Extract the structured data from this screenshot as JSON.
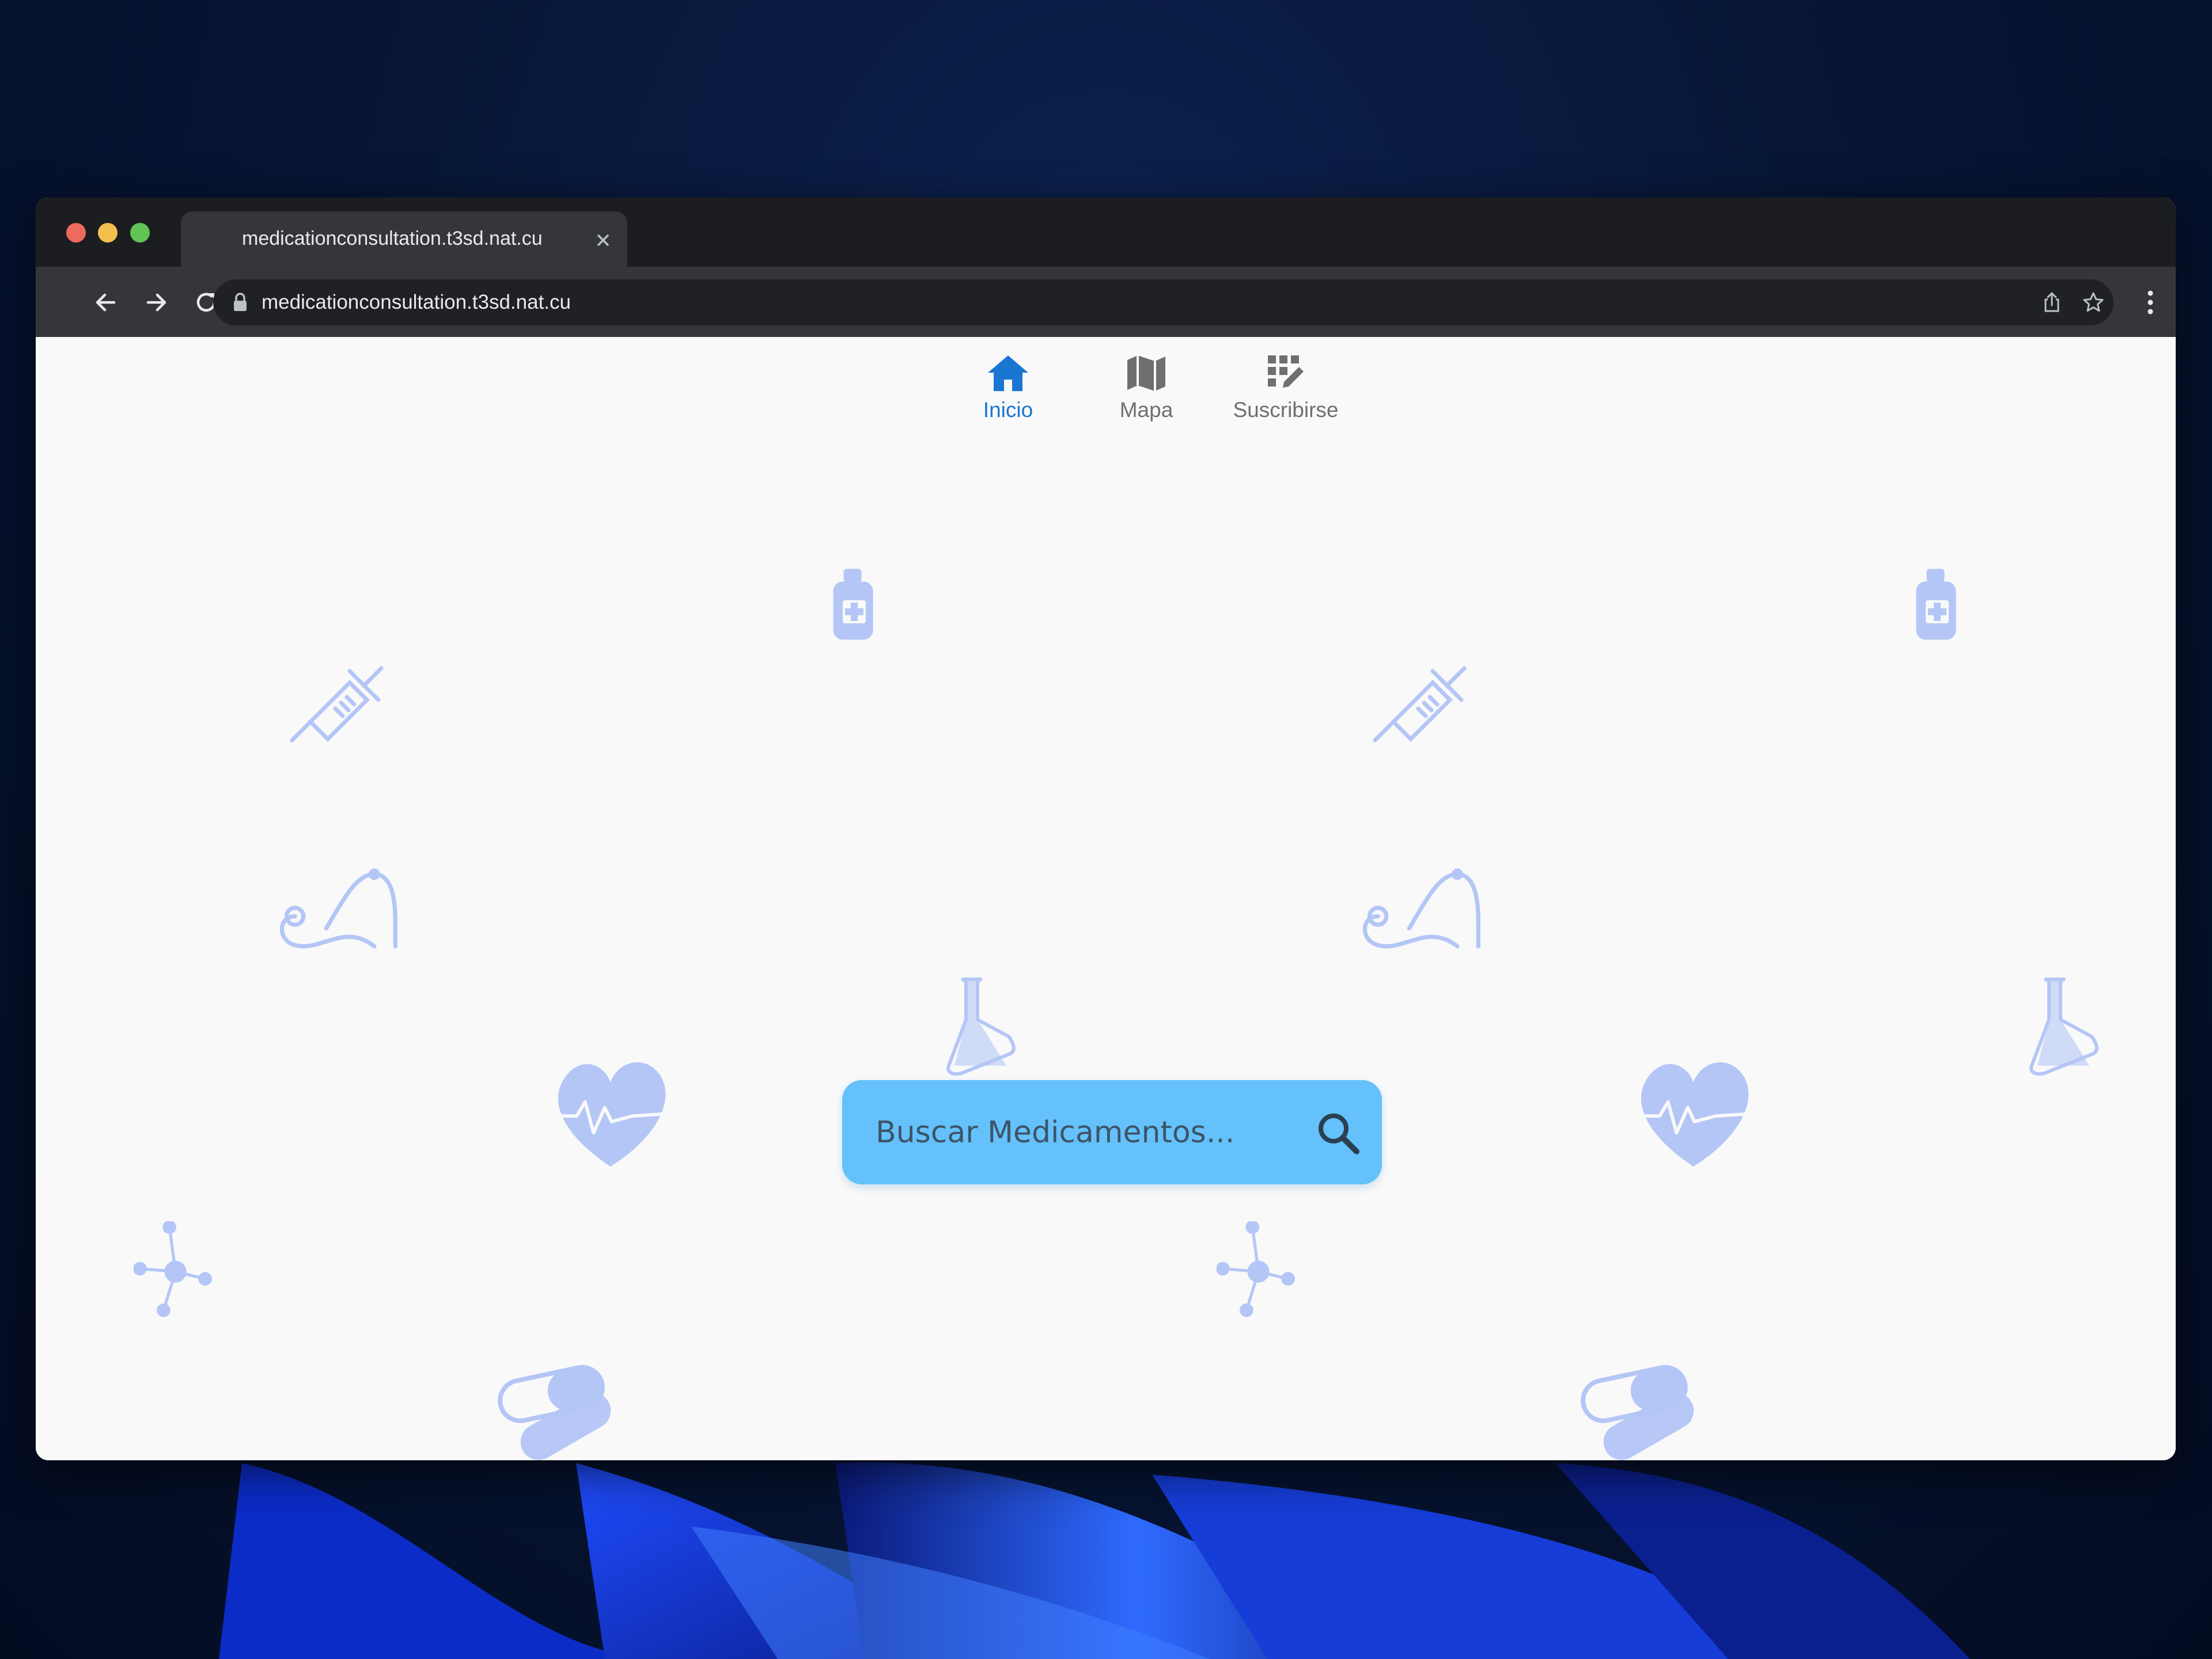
{
  "browser": {
    "tab": {
      "title": "medicationconsultation.t3sd.nat.cu",
      "close_icon": "close-icon"
    },
    "address_bar": {
      "url": "medicationconsultation.t3sd.nat.cu",
      "secure_icon": "lock-icon"
    },
    "toolbar_icons": [
      "back-arrow-icon",
      "forward-arrow-icon",
      "reload-icon",
      "share-icon",
      "bookmark-star-icon",
      "more-menu-icon"
    ]
  },
  "nav": {
    "items": [
      {
        "label": "Inicio",
        "icon": "home-icon",
        "active": true
      },
      {
        "label": "Mapa",
        "icon": "map-icon",
        "active": false
      },
      {
        "label": "Suscribirse",
        "icon": "subscribe-grid-icon",
        "active": false
      }
    ]
  },
  "search": {
    "placeholder": "Buscar Medicamentos...",
    "value": "",
    "icon": "search-icon"
  },
  "background_icons": [
    "medicine-bottle-icon",
    "syringe-icon",
    "stethoscope-icon",
    "flask-icon",
    "heartbeat-icon",
    "molecule-icon",
    "pill-capsule-icon"
  ],
  "colors": {
    "accent": "#1976d2",
    "search_bg": "#64c1fb",
    "pattern_icon": "#b4c6f6",
    "page_bg": "#f9f9fa",
    "chrome_dark": "#1c1d20",
    "toolbar": "#35363a"
  }
}
